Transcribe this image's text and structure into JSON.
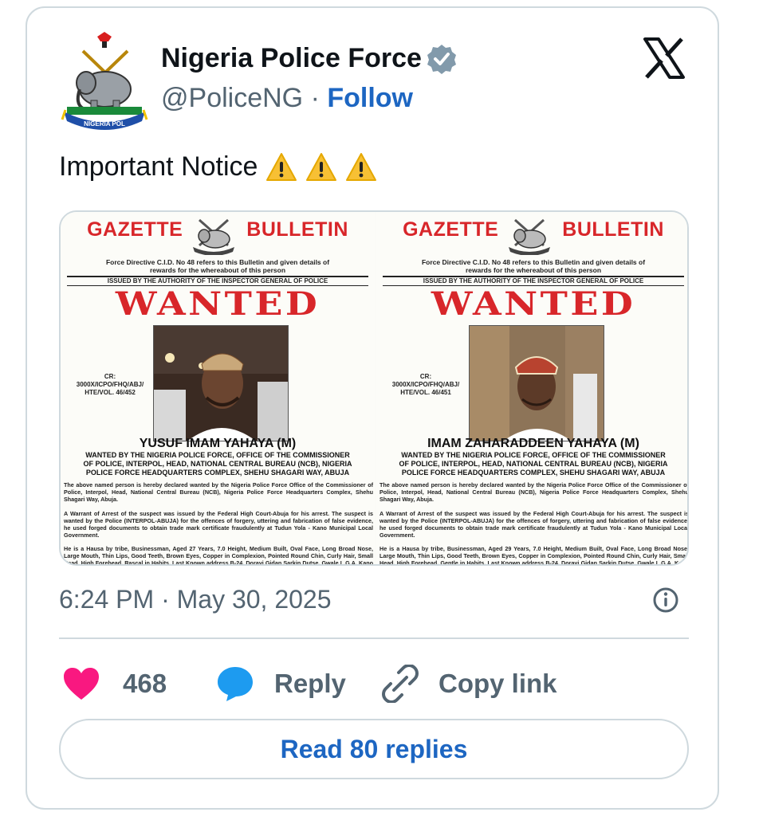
{
  "author": {
    "name": "Nigeria Police Force",
    "handle": "@PoliceNG",
    "separator": "·",
    "follow_label": "Follow",
    "avatar_text": "NIGERIA POL"
  },
  "tweet": {
    "text": "Important Notice",
    "emoji_count": 3,
    "timestamp": "6:24 PM · May 30, 2025"
  },
  "posters": [
    {
      "gazette_left": "GAZETTE",
      "gazette_right": "BULLETIN",
      "directive": "Force Directive C.I.D. No 48 refers to this Bulletin and given details of rewards for the whereabout of this person",
      "issued": "ISSUED BY THE AUTHORITY OF THE INSPECTOR GENERAL OF POLICE",
      "wanted": "WANTED",
      "cr": "CR: 3000X/ICPO/FHQ/ABJ/ HTE/VOL. 46/452",
      "name": "YUSUF IMAM YAHAYA (M)",
      "wanted_by": "WANTED BY THE NIGERIA POLICE FORCE, OFFICE OF THE COMMISSIONER OF POLICE, INTERPOL, HEAD, NATIONAL CENTRAL BUREAU (NCB), NIGERIA POLICE FORCE HEADQUARTERS COMPLEX, SHEHU SHAGARI WAY, ABUJA",
      "para1": "The above named person is hereby declared wanted by the Nigeria Police Force Office of the Commissioner of Police, Interpol, Head, National Central Bureau (NCB), Nigeria Police Force Headquarters Complex, Shehu Shagari Way, Abuja.",
      "para2": "A Warrant of Arrest of the suspect was issued by the Federal High Court-Abuja for his arrest. The suspect is wanted by the Police (INTERPOL-ABUJA) for the offences of forgery, uttering and fabrication of false evidence, he used forged documents to obtain trade mark certificate fraudulently at Tudun Yola - Kano Municipal Local Government.",
      "para3": "He is a Hausa by tribe, Businessman, Aged 27 Years, 7.0 Height, Medium Built, Oval Face, Long Broad Nose, Large Mouth, Thin Lips, Good Teeth, Brown Eyes, Copper in Complexion, Pointed Round Chin, Curly Hair, Small Head, High Forehead, Rascal in Habits, Last Known address B-24, Dorayi Gidan Sarkin Dutse, Gwale L.G.A, Kano State. The"
    },
    {
      "gazette_left": "GAZETTE",
      "gazette_right": "BULLETIN",
      "directive": "Force Directive C.I.D. No 48 refers to this Bulletin and given details of rewards for the whereabout of this person",
      "issued": "ISSUED BY THE AUTHORITY OF THE INSPECTOR GENERAL OF POLICE",
      "wanted": "WANTED",
      "cr": "CR: 3000X/ICPO/FHQ/ABJ/ HTE/VOL. 46/451",
      "name": "IMAM ZAHARADDEEN YAHAYA (M)",
      "wanted_by": "WANTED BY THE NIGERIA POLICE FORCE, OFFICE OF THE COMMISSIONER OF POLICE, INTERPOL, HEAD, NATIONAL CENTRAL BUREAU (NCB), NIGERIA POLICE FORCE HEADQUARTERS COMPLEX, SHEHU SHAGARI WAY, ABUJA",
      "para1": "The above named person is hereby declared wanted by the Nigeria Police Force Office of the Commissioner of Police, Interpol, Head, National Central Bureau (NCB), Nigeria Police Force Headquarters Complex, Shehu Shagari Way, Abuja.",
      "para2": "A Warrant of Arrest of the suspect was issued by the Federal High Court-Abuja for his arrest. The suspect is wanted by the Police (INTERPOL-ABUJA) for the offences of forgery, uttering and fabrication of false evidence, he used forged documents to obtain trade mark certificate fraudulently at Tudun Yola - Kano Municipal Local Government.",
      "para3": "He is a Hausa by tribe, Businessman, Aged 29 Years, 7.0 Height, Medium Built, Oval Face, Long Broad Nose, Large Mouth, Thin Lips, Good Teeth, Brown Eyes, Copper in Complexion, Pointed Round Chin, Curly Hair, Small Head, High Forehead, Gentle in Habits, Last Known address B-24, Dorayi Gidan Sarkin Dutse, Gwale L.G.A, Kano State. T"
    }
  ],
  "actions": {
    "like_count": "468",
    "reply_label": "Reply",
    "copy_label": "Copy link"
  },
  "read_replies_label": "Read 80 replies",
  "colors": {
    "follow": "#1d66c2",
    "heart": "#f91880",
    "reply_bubble": "#1d9bf0",
    "muted": "#536471",
    "wanted_red": "#d8262a"
  },
  "icons": [
    "police-crest-icon",
    "verified-badge-icon",
    "x-logo-icon",
    "warning-icon",
    "info-icon",
    "heart-icon",
    "reply-bubble-icon",
    "link-icon"
  ]
}
